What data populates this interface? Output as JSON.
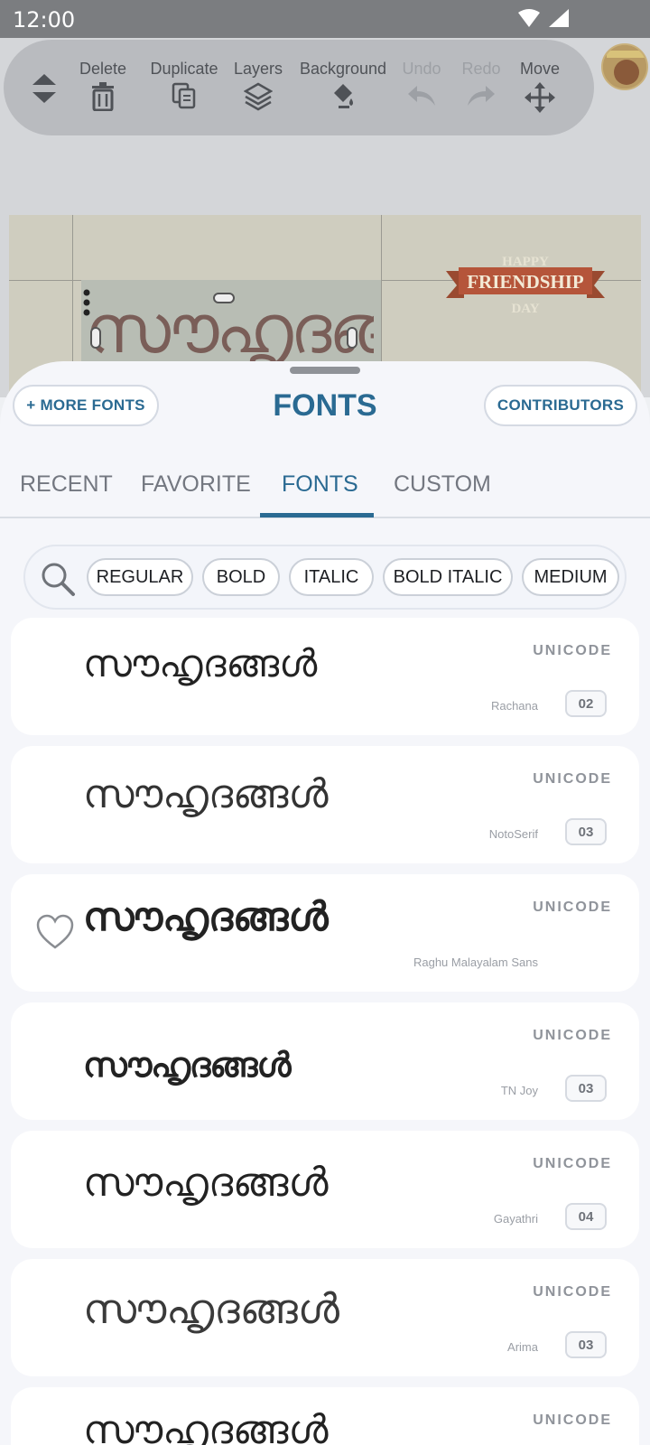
{
  "status_bar": {
    "time": "12:00"
  },
  "toolbar": {
    "items": [
      {
        "label": "Delete",
        "icon": "trash-icon",
        "enabled": true
      },
      {
        "label": "Duplicate",
        "icon": "duplicate-icon",
        "enabled": true
      },
      {
        "label": "Layers",
        "icon": "layers-icon",
        "enabled": true
      },
      {
        "label": "Background",
        "icon": "paint-bucket-icon",
        "enabled": true
      },
      {
        "label": "Undo",
        "icon": "undo-icon",
        "enabled": false
      },
      {
        "label": "Redo",
        "icon": "redo-icon",
        "enabled": false
      },
      {
        "label": "Move",
        "icon": "move-icon",
        "enabled": true
      }
    ]
  },
  "canvas": {
    "text": "സൗഹൃദങ്ങൾ",
    "sticker": {
      "line1": "HAPPY",
      "line2": "FRIENDSHIP",
      "line3": "DAY"
    }
  },
  "sheet": {
    "title": "FONTS",
    "more_fonts_label": "+ MORE FONTS",
    "contributors_label": "CONTRIBUTORS",
    "tabs": [
      {
        "label": "RECENT",
        "active": false
      },
      {
        "label": "FAVORITE",
        "active": false
      },
      {
        "label": "FONTS",
        "active": true
      },
      {
        "label": "CUSTOM",
        "active": false
      }
    ],
    "filters": [
      "REGULAR",
      "BOLD",
      "ITALIC",
      "BOLD ITALIC",
      "MEDIUM"
    ],
    "fonts": [
      {
        "sample": "സൗഹൃദങ്ങൾ",
        "type": "UNICODE",
        "name": "Rachana",
        "count": "02"
      },
      {
        "sample": "സൗഹൃദങ്ങൾ",
        "type": "UNICODE",
        "name": "NotoSerif",
        "count": "03"
      },
      {
        "sample": "സൗഹൃദങ്ങൾ",
        "type": "UNICODE",
        "name": "Raghu Malayalam Sans",
        "count": ""
      },
      {
        "sample": "സൗഹൃദങ്ങൾ",
        "type": "UNICODE",
        "name": "TN Joy",
        "count": "03"
      },
      {
        "sample": "സൗഹൃദങ്ങൾ",
        "type": "UNICODE",
        "name": "Gayathri",
        "count": "04"
      },
      {
        "sample": "സൗഹൃദങ്ങൾ",
        "type": "UNICODE",
        "name": "Arima",
        "count": "03"
      },
      {
        "sample": "സൗഹൃദങ്ങൾ",
        "type": "UNICODE",
        "name": "",
        "count": ""
      }
    ]
  },
  "colors": {
    "accent": "#2a6a92",
    "sheet_bg": "#f5f6fa",
    "card_bg": "#ffffff",
    "muted_text": "#8f939a"
  }
}
